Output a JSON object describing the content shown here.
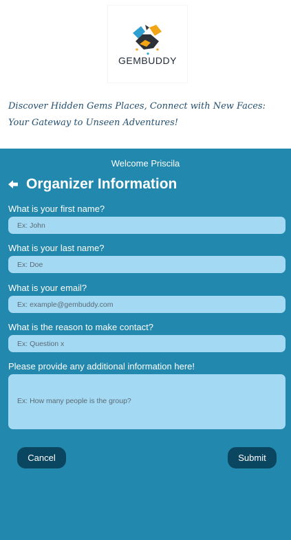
{
  "brand": {
    "logo_text": "GEMBUDDY",
    "tagline": "Discover Hidden Gems Places, Connect with New Faces: Your Gateway to Unseen Adventures!"
  },
  "panel": {
    "welcome": "Welcome Priscila",
    "back_icon": "arrow-left-icon",
    "title": "Organizer Information"
  },
  "form": {
    "first_name": {
      "label": "What is your first name?",
      "placeholder": "Ex: John",
      "value": ""
    },
    "last_name": {
      "label": "What is your last name?",
      "placeholder": "Ex: Doe",
      "value": ""
    },
    "email": {
      "label": "What is your email?",
      "placeholder": "Ex: example@gembuddy.com",
      "value": ""
    },
    "reason": {
      "label": "What is the reason to make contact?",
      "placeholder": "Ex: Question x",
      "value": ""
    },
    "additional": {
      "label": "Please provide any additional information here!",
      "placeholder": "Ex: How many people is the group?",
      "value": ""
    },
    "cancel_label": "Cancel",
    "submit_label": "Submit"
  },
  "colors": {
    "panel_bg": "#2288ad",
    "field_bg": "#a4d9f3",
    "button_bg": "#0b4660",
    "tagline": "#244f6e"
  }
}
